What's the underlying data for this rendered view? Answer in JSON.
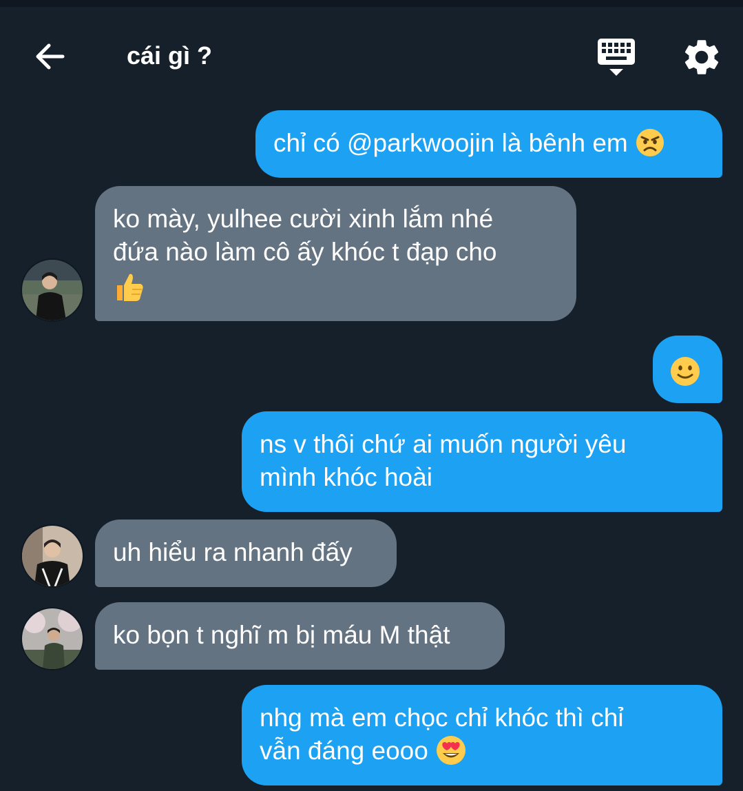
{
  "header": {
    "title": "cái gì ?",
    "icons": {
      "back": "arrow-left-icon",
      "keyboard": "keyboard-icon",
      "settings": "gear-icon"
    }
  },
  "colors": {
    "background": "#15202b",
    "outgoing_bubble": "#1da1f2",
    "incoming_bubble": "#647382",
    "text": "#ffffff"
  },
  "messages": [
    {
      "direction": "outgoing",
      "lines": [
        "chỉ có @parkwoojin là bênh em"
      ],
      "emoji": "angry-face-emoji"
    },
    {
      "direction": "incoming",
      "lines": [
        "ko mày, yulhee cười xinh lắm nhé",
        "đứa nào làm cô ấy khóc t đạp cho"
      ],
      "emoji": "thumbs-up-emoji",
      "avatar": "avatar-1"
    },
    {
      "direction": "outgoing",
      "lines": [],
      "emoji": "slightly-smiling-face-emoji"
    },
    {
      "direction": "outgoing",
      "lines": [
        "ns v thôi chứ ai muốn người yêu",
        "mình khóc hoài"
      ]
    },
    {
      "direction": "incoming",
      "lines": [
        "uh hiểu ra nhanh đấy"
      ],
      "avatar": "avatar-2"
    },
    {
      "direction": "incoming",
      "lines": [
        "ko bọn t nghĩ m bị máu M thật"
      ],
      "avatar": "avatar-3"
    },
    {
      "direction": "outgoing",
      "lines": [
        "nhg mà em chọc chỉ khóc thì chỉ",
        "vẫn đáng eooo"
      ],
      "emoji": "heart-eyes-emoji"
    }
  ]
}
